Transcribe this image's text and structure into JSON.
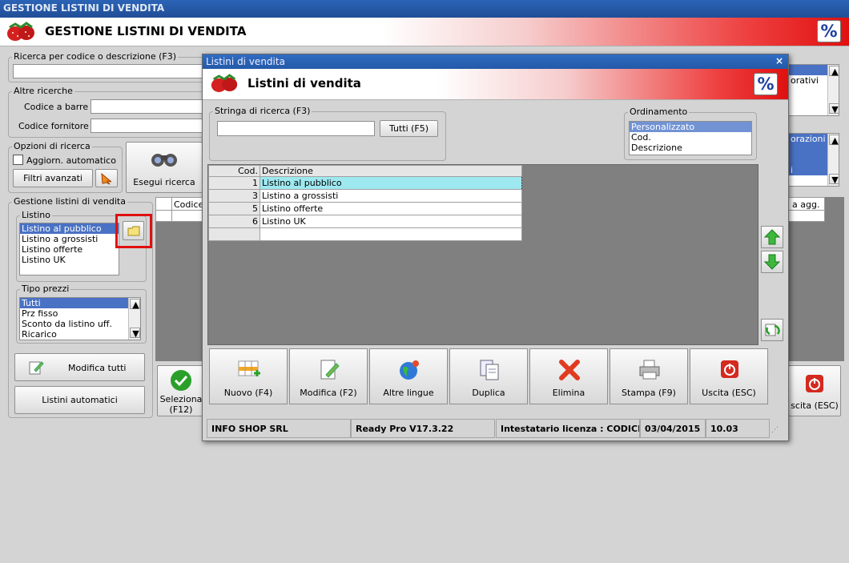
{
  "window": {
    "title": "GESTIONE LISTINI DI VENDITA"
  },
  "banner": {
    "title": "GESTIONE LISTINI DI VENDITA",
    "pct": "%"
  },
  "search": {
    "label": "Ricerca per codice o descrizione (F3)",
    "value": ""
  },
  "other": {
    "label": "Altre ricerche",
    "barcode_label": "Codice a barre :",
    "supplier_label": "Codice fornitore :"
  },
  "options": {
    "label": "Opzioni di ricerca",
    "auto_update": "Aggiorn. automatico",
    "advanced_button": "Filtri avanzati",
    "search_button": "Esegui ricerca"
  },
  "gestione": {
    "label": "Gestione listini di vendita",
    "listino_label": "Listino",
    "listino_items": [
      "Listino al pubblico",
      "Listino a grossisti",
      "Listino offerte",
      "Listino UK"
    ],
    "tipo_label": "Tipo prezzi",
    "tipo_items": [
      "Tutti",
      "Prz fisso",
      "Sconto da listino uff.",
      "Ricarico"
    ],
    "modify_all": "Modifica tutti",
    "automatic": "Listini automatici"
  },
  "bg_grid": {
    "col_codice": "Codice",
    "col_agg": "a agg."
  },
  "bg_right": {
    "item1": "orativi",
    "item2": "orazioni",
    "item3": "i"
  },
  "bg_bottom": {
    "select_label": "Seleziona\n(F12)",
    "exit_label": "scita (ESC)"
  },
  "dialog": {
    "title": "Listini di vendita",
    "close": "×",
    "banner_title": "Listini di vendita",
    "search_label": "Stringa di ricerca (F3)",
    "search_value": "",
    "all_button": "Tutti (F5)",
    "order_label": "Ordinamento",
    "order_items": [
      "Personalizzato",
      "Cod.",
      "Descrizione"
    ],
    "table": {
      "headers": [
        "Cod.",
        "Descrizione"
      ],
      "rows": [
        {
          "cod": "1",
          "desc": "Listino al pubblico"
        },
        {
          "cod": "3",
          "desc": "Listino a grossisti"
        },
        {
          "cod": "5",
          "desc": "Listino offerte"
        },
        {
          "cod": "6",
          "desc": "Listino UK"
        }
      ]
    },
    "toolbar": {
      "new": "Nuovo (F4)",
      "edit": "Modifica (F2)",
      "lang": "Altre lingue",
      "dup": "Duplica",
      "del": "Elimina",
      "print": "Stampa (F9)",
      "exit": "Uscita (ESC)"
    },
    "status": {
      "company": "INFO SHOP SRL",
      "version": "Ready Pro V17.3.22",
      "license": "Intestatario licenza : CODICE SI",
      "date": "03/04/2015",
      "time": "10.03"
    }
  }
}
